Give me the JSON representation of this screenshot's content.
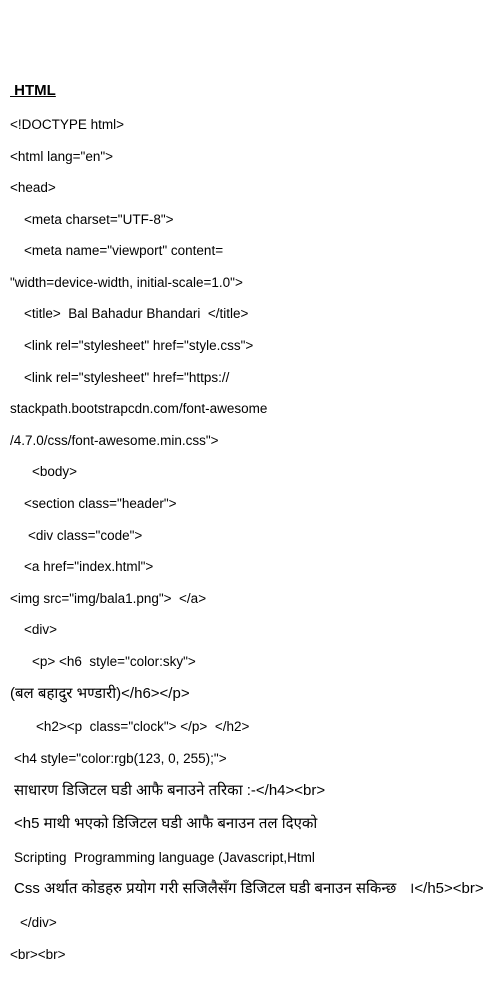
{
  "heading": " HTML",
  "lines": [
    "<!DOCTYPE html>",
    "<html lang=\"en\">",
    "<head>",
    "<meta charset=\"UTF-8\">",
    "<meta name=\"viewport\" content=",
    "\"width=device-width, initial-scale=1.0\">",
    "<title>  Bal Bahadur Bhandari  </title>",
    "<link rel=\"stylesheet\" href=\"style.css\">",
    "<link rel=\"stylesheet\" href=\"https://",
    "stackpath.bootstrapcdn.com/font-awesome",
    "/4.7.0/css/font-awesome.min.css\">",
    "<body>",
    "<section class=\"header\">",
    "<div class=\"code\">",
    "<a href=\"index.html\">",
    "<img src=\"img/bala1.png\">  </a>",
    "<div>",
    "<p> <h6  style=\"color:sky\">",
    "(बल बहादुर भण्डारी)</h6></p>",
    "<h2><p  class=\"clock\"> </p>  </h2>",
    "<h4 style=\"color:rgb(123, 0, 255);\">",
    "साधारण डिजिटल घडी आफै बनाउने तरिका :-</h4><br>",
    "<h5 माथी भएको डिजिटल घडी आफै बनाउन तल दिएको",
    "Scripting  Programming language (Javascript,Html ",
    "Css अर्थात कोडहरु प्रयोग गरी सजिलैसँग डिजिटल घडी बनाउन सकिन्छ   ।</h5><br>",
    "</div>",
    "<br><br>"
  ]
}
